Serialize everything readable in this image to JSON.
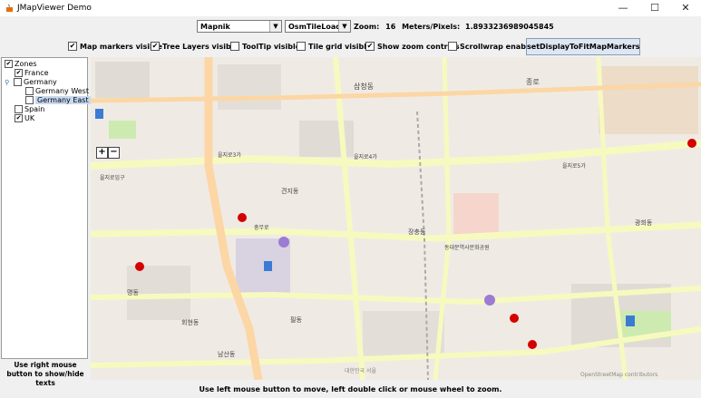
{
  "window": {
    "title": "JMapViewer Demo",
    "minimize": "—",
    "maximize": "☐",
    "close": "✕"
  },
  "toolbar": {
    "tile_source": "Mapnik",
    "tile_loader": "OsmTileLoader",
    "zoom_label": "Zoom:",
    "zoom_value": "16",
    "mpp_label": "Meters/Pixels:",
    "mpp_value": "1.8933236989045845"
  },
  "options": [
    {
      "label": "Map markers visible",
      "checked": true
    },
    {
      "label": "Tree Layers visible",
      "checked": true
    },
    {
      "label": "ToolTip visible",
      "checked": false
    },
    {
      "label": "Tile grid visible",
      "checked": false
    },
    {
      "label": "Show zoom controls",
      "checked": true
    },
    {
      "label": "Scrollwrap enabled",
      "checked": false
    }
  ],
  "fit_button": "setDisplayToFitMapMarkers",
  "tree": {
    "items": [
      {
        "label": "Zones",
        "checked": true
      },
      {
        "label": "France",
        "checked": true
      },
      {
        "label": "Germany",
        "checked": false
      },
      {
        "label": "Germany West",
        "checked": false
      },
      {
        "label": "Germany East",
        "checked": false
      },
      {
        "label": "Spain",
        "checked": false
      },
      {
        "label": "UK",
        "checked": true
      }
    ],
    "hint": "Use right mouse button to show/hide texts"
  },
  "map": {
    "zoom_in": "+",
    "zoom_out": "−",
    "labels": [
      "삼청동",
      "청운동",
      "견지동",
      "을지로입구",
      "을지로3가",
      "을지로4가",
      "을지로5가",
      "충무로",
      "명동",
      "필동",
      "장충동",
      "동대문역사문화공원",
      "광희동",
      "종로",
      "회현동",
      "남산동",
      "대한민국 서울"
    ],
    "attribution": "OpenStreetMap contributors"
  },
  "status": "Use left mouse button to move, left double click or mouse wheel to zoom."
}
